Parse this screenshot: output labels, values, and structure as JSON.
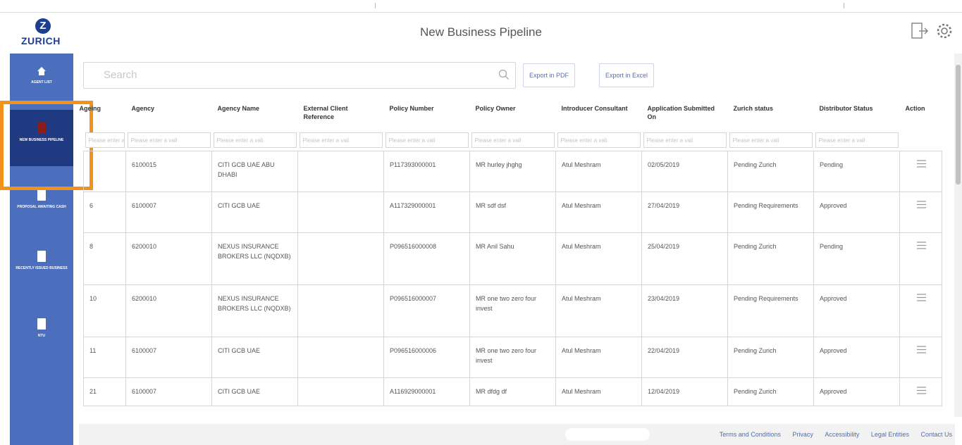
{
  "brand": {
    "logo_text": "ZURICH",
    "logo_mark": "Z",
    "accent": "#1d3f8f",
    "sidebar_color": "#4b6fbc",
    "sidebar_active_color": "#1f3a80",
    "highlight_color": "#f0921c"
  },
  "header": {
    "title": "New Business Pipeline",
    "icons": [
      "logout-icon",
      "settings-gear-icon"
    ]
  },
  "sidebar": {
    "items": [
      {
        "label": "AGENT LIST",
        "icon": "home-icon",
        "active": false
      },
      {
        "label": "NEW BUSINESS PIPELINE",
        "icon": "document-icon",
        "active": true
      },
      {
        "label": "PROPOSAL AWAITING CASH",
        "icon": "document-icon",
        "active": false
      },
      {
        "label": "RECENTLY ISSUED BUSINESS",
        "icon": "clipboard-icon",
        "active": false
      },
      {
        "label": "NTU",
        "icon": "document-icon",
        "active": false
      }
    ]
  },
  "toolbar": {
    "search_placeholder": "Search",
    "export_pdf": "Export in PDF",
    "export_excel": "Export in Excel"
  },
  "table": {
    "columns": [
      "Ageing",
      "Agency",
      "Agency Name",
      "External Client Reference",
      "Policy Number",
      "Policy Owner",
      "Introducer Consultant",
      "Application Submitted On",
      "Zurich status",
      "Distributor Status",
      "Action"
    ],
    "filter_placeholder": "Please enter a vali",
    "rows": [
      {
        "ageing": "",
        "agency": "6100015",
        "agency_name": "CITI GCB UAE ABU DHABI",
        "ext_ref": "",
        "policy_number": "P117393000001",
        "policy_owner": "MR hurley jhghg",
        "consultant": "Atul Meshram",
        "submitted": "02/05/2019",
        "zurich_status": "Pending Zurich",
        "distributor_status": "Pending"
      },
      {
        "ageing": "6",
        "agency": "6100007",
        "agency_name": "CITI GCB UAE",
        "ext_ref": "",
        "policy_number": "A117329000001",
        "policy_owner": "MR sdf dsf",
        "consultant": "Atul Meshram",
        "submitted": "27/04/2019",
        "zurich_status": "Pending Requirements",
        "distributor_status": "Approved"
      },
      {
        "ageing": "8",
        "agency": "6200010",
        "agency_name": "NEXUS INSURANCE BROKERS LLC (NQDXB)",
        "ext_ref": "",
        "policy_number": "P096516000008",
        "policy_owner": "MR Anil Sahu",
        "consultant": "Atul Meshram",
        "submitted": "25/04/2019",
        "zurich_status": "Pending Zurich",
        "distributor_status": "Pending"
      },
      {
        "ageing": "10",
        "agency": "6200010",
        "agency_name": "NEXUS INSURANCE BROKERS LLC (NQDXB)",
        "ext_ref": "",
        "policy_number": "P096516000007",
        "policy_owner": "MR one two zero four invest",
        "consultant": "Atul Meshram",
        "submitted": "23/04/2019",
        "zurich_status": "Pending Requirements",
        "distributor_status": "Approved"
      },
      {
        "ageing": "11",
        "agency": "6100007",
        "agency_name": "CITI GCB UAE",
        "ext_ref": "",
        "policy_number": "P096516000006",
        "policy_owner": "MR one two zero four invest",
        "consultant": "Atul Meshram",
        "submitted": "22/04/2019",
        "zurich_status": "Pending Zurich",
        "distributor_status": "Approved"
      },
      {
        "ageing": "21",
        "agency": "6100007",
        "agency_name": "CITI GCB UAE",
        "ext_ref": "",
        "policy_number": "A116929000001",
        "policy_owner": "MR dfdg df",
        "consultant": "Atul Meshram",
        "submitted": "12/04/2019",
        "zurich_status": "Pending Zurich",
        "distributor_status": "Approved"
      }
    ]
  },
  "footer": {
    "links": [
      "Terms and Conditions",
      "Privacy",
      "Accessibility",
      "Legal Entities",
      "Contact Us"
    ]
  }
}
